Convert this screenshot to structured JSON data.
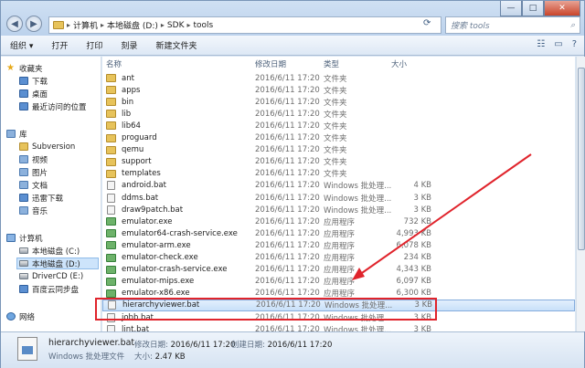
{
  "window": {
    "minimize": "—",
    "maximize": "□",
    "close": "✕"
  },
  "address": {
    "segments": [
      "计算机",
      "本地磁盘 (D:)",
      "SDK",
      "tools"
    ],
    "separator": "▸"
  },
  "search": {
    "placeholder": "搜索 tools"
  },
  "toolbar": {
    "organize": "组织 ▾",
    "open": "打开",
    "print": "打印",
    "burn": "刻录",
    "new_folder": "新建文件夹"
  },
  "sidebar": {
    "favorites": {
      "label": "收藏夹",
      "items": [
        "下载",
        "桌面",
        "最近访问的位置"
      ]
    },
    "libraries": {
      "label": "库",
      "items": [
        "Subversion",
        "视频",
        "图片",
        "文档",
        "迅雷下载",
        "音乐"
      ]
    },
    "computer": {
      "label": "计算机",
      "items": [
        "本地磁盘 (C:)",
        "本地磁盘 (D:)",
        "DriverCD (E:)",
        "百度云同步盘"
      ]
    },
    "network": {
      "label": "网络"
    }
  },
  "columns": {
    "name": "名称",
    "date": "修改日期",
    "type": "类型",
    "size": "大小"
  },
  "files": [
    {
      "name": "ant",
      "date": "2016/6/11 17:20",
      "type": "文件夹",
      "size": "",
      "kind": "folder"
    },
    {
      "name": "apps",
      "date": "2016/6/11 17:20",
      "type": "文件夹",
      "size": "",
      "kind": "folder"
    },
    {
      "name": "bin",
      "date": "2016/6/11 17:20",
      "type": "文件夹",
      "size": "",
      "kind": "folder"
    },
    {
      "name": "lib",
      "date": "2016/6/11 17:20",
      "type": "文件夹",
      "size": "",
      "kind": "folder"
    },
    {
      "name": "lib64",
      "date": "2016/6/11 17:20",
      "type": "文件夹",
      "size": "",
      "kind": "folder"
    },
    {
      "name": "proguard",
      "date": "2016/6/11 17:20",
      "type": "文件夹",
      "size": "",
      "kind": "folder"
    },
    {
      "name": "qemu",
      "date": "2016/6/11 17:20",
      "type": "文件夹",
      "size": "",
      "kind": "folder"
    },
    {
      "name": "support",
      "date": "2016/6/11 17:20",
      "type": "文件夹",
      "size": "",
      "kind": "folder"
    },
    {
      "name": "templates",
      "date": "2016/6/11 17:20",
      "type": "文件夹",
      "size": "",
      "kind": "folder"
    },
    {
      "name": "android.bat",
      "date": "2016/6/11 17:20",
      "type": "Windows 批处理...",
      "size": "4 KB",
      "kind": "bat"
    },
    {
      "name": "ddms.bat",
      "date": "2016/6/11 17:20",
      "type": "Windows 批处理...",
      "size": "3 KB",
      "kind": "bat"
    },
    {
      "name": "draw9patch.bat",
      "date": "2016/6/11 17:20",
      "type": "Windows 批处理...",
      "size": "3 KB",
      "kind": "bat"
    },
    {
      "name": "emulator.exe",
      "date": "2016/6/11 17:20",
      "type": "应用程序",
      "size": "732 KB",
      "kind": "exe"
    },
    {
      "name": "emulator64-crash-service.exe",
      "date": "2016/6/11 17:20",
      "type": "应用程序",
      "size": "4,993 KB",
      "kind": "exe"
    },
    {
      "name": "emulator-arm.exe",
      "date": "2016/6/11 17:20",
      "type": "应用程序",
      "size": "6,078 KB",
      "kind": "exe"
    },
    {
      "name": "emulator-check.exe",
      "date": "2016/6/11 17:20",
      "type": "应用程序",
      "size": "234 KB",
      "kind": "exe"
    },
    {
      "name": "emulator-crash-service.exe",
      "date": "2016/6/11 17:20",
      "type": "应用程序",
      "size": "4,343 KB",
      "kind": "exe"
    },
    {
      "name": "emulator-mips.exe",
      "date": "2016/6/11 17:20",
      "type": "应用程序",
      "size": "6,097 KB",
      "kind": "exe"
    },
    {
      "name": "emulator-x86.exe",
      "date": "2016/6/11 17:20",
      "type": "应用程序",
      "size": "6,300 KB",
      "kind": "exe"
    },
    {
      "name": "hierarchyviewer.bat",
      "date": "2016/6/11 17:20",
      "type": "Windows 批处理...",
      "size": "3 KB",
      "kind": "bat",
      "selected": true
    },
    {
      "name": "jobb.bat",
      "date": "2016/6/11 17:20",
      "type": "Windows 批处理...",
      "size": "3 KB",
      "kind": "bat"
    },
    {
      "name": "lint.bat",
      "date": "2016/6/11 17:20",
      "type": "Windows 批处理...",
      "size": "3 KB",
      "kind": "bat"
    }
  ],
  "details": {
    "filename": "hierarchyviewer.bat",
    "filetype": "Windows 批处理文件",
    "modified_label": "修改日期:",
    "modified_value": "2016/6/11 17:20",
    "created_label": "创建日期:",
    "created_value": "2016/6/11 17:20",
    "size_label": "大小:",
    "size_value": "2.47 KB"
  },
  "annotation_color": "#e0242c"
}
